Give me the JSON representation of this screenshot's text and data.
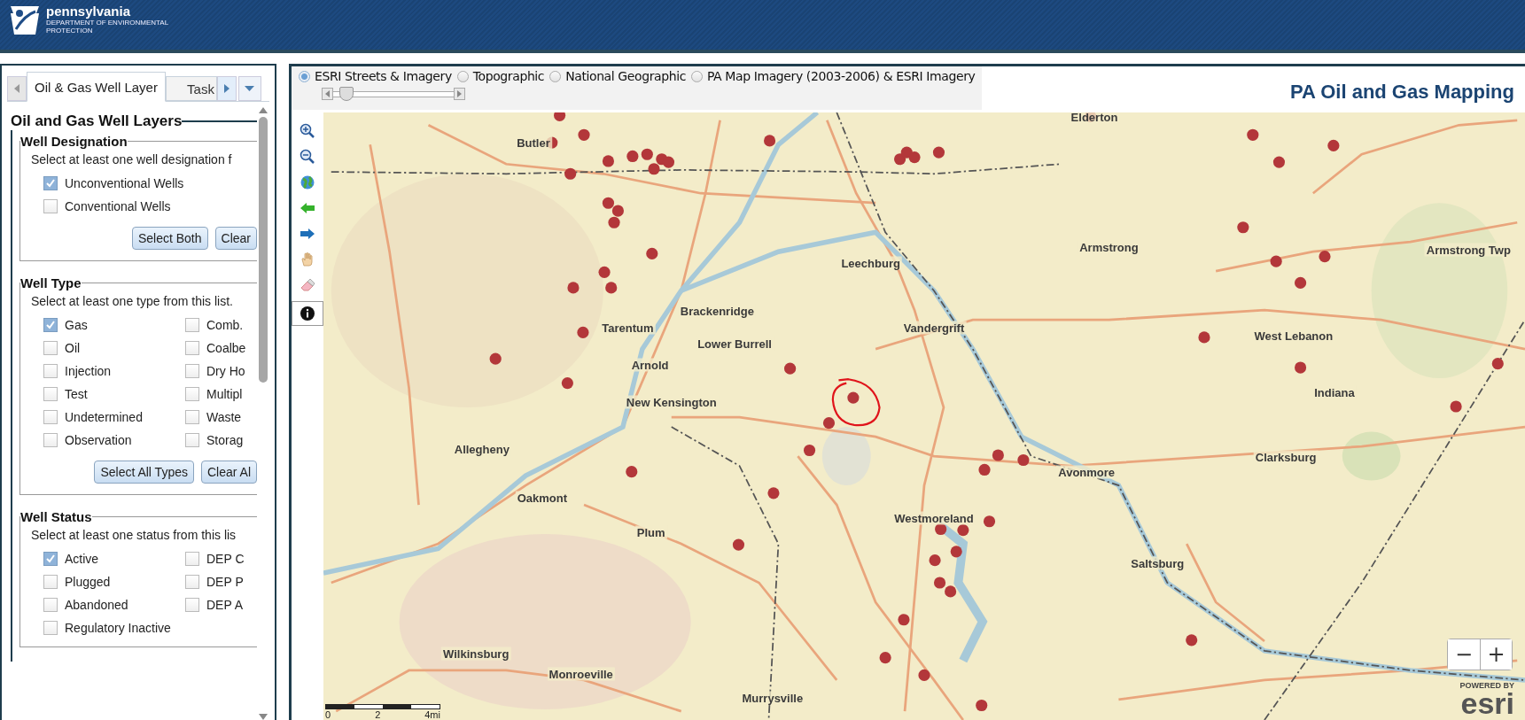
{
  "header": {
    "logo_title": "pennsylvania",
    "logo_subtitle": [
      "DEPARTMENT OF ENVIRONMENTAL",
      "PROTECTION"
    ]
  },
  "side_panel": {
    "tabs": [
      {
        "label": "Oil & Gas Well Layer",
        "selected": true
      },
      {
        "label": "Task",
        "selected": false
      }
    ],
    "title": "Oil and Gas Well Layers",
    "sections": [
      {
        "title": "Well Designation",
        "instruction": "Select at least one well designation f",
        "columns": [
          [
            {
              "label": "Unconventional Wells",
              "checked": true
            },
            {
              "label": "Conventional Wells",
              "checked": false
            }
          ]
        ],
        "buttons": [
          "Select Both",
          "Clear"
        ]
      },
      {
        "title": "Well Type",
        "instruction": "Select at least one type from this list.",
        "columns": [
          [
            {
              "label": "Gas",
              "checked": true
            },
            {
              "label": "Oil",
              "checked": false
            },
            {
              "label": "Injection",
              "checked": false
            },
            {
              "label": "Test",
              "checked": false
            },
            {
              "label": "Undetermined",
              "checked": false
            },
            {
              "label": "Observation",
              "checked": false
            }
          ],
          [
            {
              "label": "Comb.",
              "checked": false
            },
            {
              "label": "Coalbe",
              "checked": false
            },
            {
              "label": "Dry Ho",
              "checked": false
            },
            {
              "label": "Multipl",
              "checked": false
            },
            {
              "label": "Waste",
              "checked": false
            },
            {
              "label": "Storag",
              "checked": false
            }
          ]
        ],
        "buttons": [
          "Select All Types",
          "Clear Al"
        ]
      },
      {
        "title": "Well Status",
        "instruction": "Select at least one status from this lis",
        "columns": [
          [
            {
              "label": "Active",
              "checked": true
            },
            {
              "label": "Plugged",
              "checked": false
            },
            {
              "label": "Abandoned",
              "checked": false
            },
            {
              "label": "Regulatory Inactive",
              "checked": false
            }
          ],
          [
            {
              "label": "DEP C",
              "checked": false
            },
            {
              "label": "DEP P",
              "checked": false
            },
            {
              "label": "DEP A",
              "checked": false
            }
          ]
        ]
      }
    ]
  },
  "map": {
    "basemaps": [
      {
        "label": "ESRI Streets & Imagery",
        "selected": true
      },
      {
        "label": "Topographic",
        "selected": false
      },
      {
        "label": "National Geographic",
        "selected": false
      },
      {
        "label": "PA Map Imagery (2003-2006) & ESRI Imagery",
        "selected": false
      }
    ],
    "transparency_slider": {
      "level": 0.05
    },
    "title": "PA Oil and Gas Mapping",
    "tools": [
      {
        "kind": "zoom_in",
        "selected": false
      },
      {
        "kind": "zoom_out",
        "selected": false
      },
      {
        "kind": "full_extent",
        "selected": false
      },
      {
        "kind": "previous",
        "selected": false
      },
      {
        "kind": "next",
        "selected": false
      },
      {
        "kind": "pan",
        "selected": false
      },
      {
        "kind": "clear",
        "selected": false
      },
      {
        "kind": "identify",
        "selected": true
      }
    ],
    "place_labels": [
      "Butler",
      "Elderton",
      "Leechburg",
      "Armstrong",
      "Armstrong Twp",
      "Brackenridge",
      "Tarentum",
      "Lower Burrell",
      "Vandergrift",
      "West Lebanon",
      "Arnold",
      "New Kensington",
      "Indiana",
      "Clarksburg",
      "Allegheny",
      "Avonmore",
      "Oakmont",
      "Westmoreland",
      "Plum",
      "Saltsburg",
      "Wilkinsburg",
      "Monroeville",
      "Murrysville"
    ],
    "scale_labels": [
      "0",
      "2",
      "4mi"
    ],
    "zoom_buttons": [
      "−",
      "+"
    ],
    "attribution": {
      "powered_by": "POWERED BY",
      "logo": "esri"
    }
  }
}
